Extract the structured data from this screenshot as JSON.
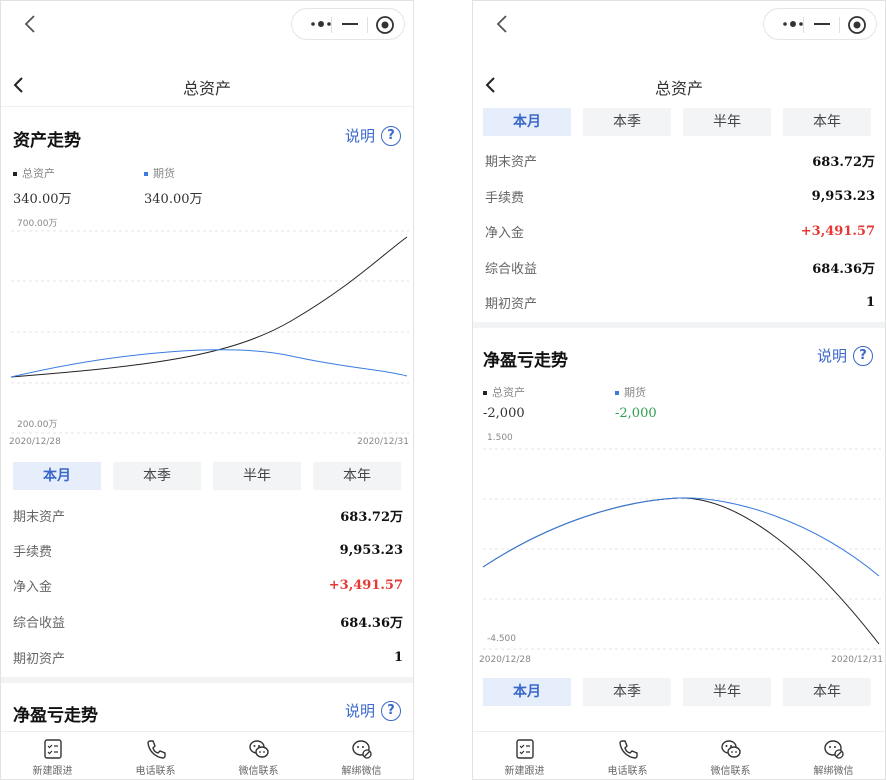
{
  "nav": {
    "title": "总资产"
  },
  "asset_trend": {
    "title": "资产走势",
    "help_label": "说明",
    "help_icon": "?",
    "legend": [
      {
        "name": "总资产",
        "value": "340.00万",
        "color": "#222222"
      },
      {
        "name": "期货",
        "value": "340.00万",
        "color": "#3a7be0"
      }
    ],
    "y_top_label": "700.00万",
    "y_bottom_label": "200.00万",
    "x_start": "2020/12/28",
    "x_end": "2020/12/31"
  },
  "pnl_trend": {
    "title": "净盈亏走势",
    "help_label": "说明",
    "help_icon": "?",
    "legend": [
      {
        "name": "总资产",
        "value": "-2,000",
        "color": "#222222"
      },
      {
        "name": "期货",
        "value": "-2,000",
        "color": "#3a7be0"
      }
    ],
    "y_top_label": "1.500",
    "y_bottom_label": "-4.500",
    "x_start": "2020/12/28",
    "x_end": "2020/12/31"
  },
  "periods": [
    "本月",
    "本季",
    "半年",
    "本年"
  ],
  "summary": [
    {
      "label": "期末资产",
      "value": "683.72万"
    },
    {
      "label": "手续费",
      "value": "9,953.23"
    },
    {
      "label": "净入金",
      "value": "+3,491.57"
    },
    {
      "label": "综合收益",
      "value": "684.36万"
    },
    {
      "label": "期初资产",
      "value": "1"
    }
  ],
  "tabbar": [
    {
      "label": "新建跟进",
      "icon": "checklist-icon"
    },
    {
      "label": "电话联系",
      "icon": "phone-icon"
    },
    {
      "label": "微信联系",
      "icon": "wechat-icon"
    },
    {
      "label": "解绑微信",
      "icon": "wechat-unbind-icon"
    }
  ],
  "colors": {
    "accent": "#3a68c9",
    "positive": "#e53935",
    "negative": "#2e9e4f",
    "total_line": "#222222",
    "futures_line": "#3a7be0"
  }
}
